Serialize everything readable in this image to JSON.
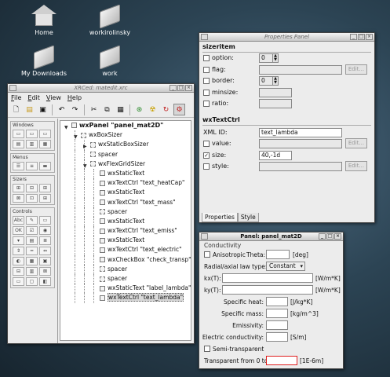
{
  "desktop": {
    "icons": [
      "Home",
      "workirolinsky",
      "My Downloads",
      "work"
    ]
  },
  "xrced": {
    "title": "XRCed: matedit.xrc",
    "menu": [
      "File",
      "Edit",
      "View",
      "Help"
    ],
    "toolbar_icons": [
      "new-icon",
      "open-icon",
      "save-icon",
      "undo-icon",
      "redo-icon",
      "cut-icon",
      "copy-icon",
      "paste-icon",
      "test-icon",
      "locate-icon",
      "refresh-icon",
      "auto-refresh-icon"
    ],
    "palette": [
      {
        "title": "Windows",
        "count": 6
      },
      {
        "title": "Menus",
        "count": 3
      },
      {
        "title": "Sizers",
        "count": 6
      },
      {
        "title": "Controls",
        "count": 21
      }
    ],
    "tree": [
      {
        "label": "wxPanel \"panel_mat2D\"",
        "level": 0,
        "root": true,
        "expander": "▼"
      },
      {
        "label": "wxBoxSizer",
        "level": 1,
        "expander": "▼"
      },
      {
        "label": "wxStaticBoxSizer",
        "level": 2,
        "expander": "▶"
      },
      {
        "label": "spacer",
        "level": 2
      },
      {
        "label": "wxFlexGridSizer",
        "level": 2,
        "expander": "▼"
      },
      {
        "label": "wxStaticText",
        "level": 3
      },
      {
        "label": "wxTextCtrl \"text_heatCap\"",
        "level": 3
      },
      {
        "label": "wxStaticText",
        "level": 3
      },
      {
        "label": "wxTextCtrl \"text_mass\"",
        "level": 3
      },
      {
        "label": "spacer",
        "level": 3
      },
      {
        "label": "wxStaticText",
        "level": 3
      },
      {
        "label": "wxTextCtrl \"text_emiss\"",
        "level": 3
      },
      {
        "label": "wxStaticText",
        "level": 3
      },
      {
        "label": "wxTextCtrl \"text_electric\"",
        "level": 3
      },
      {
        "label": "wxCheckBox \"check_transp\"",
        "level": 3
      },
      {
        "label": "spacer",
        "level": 3
      },
      {
        "label": "spacer",
        "level": 3
      },
      {
        "label": "wxStaticText \"label_lambda\"",
        "level": 3
      },
      {
        "label": "wxTextCtrl \"text_lambda\"",
        "level": 3,
        "selected": true
      }
    ]
  },
  "props": {
    "title": "Properties Panel",
    "sizeritem_header": "sizeritem",
    "option_label": "option:",
    "option_value": "0",
    "flag_label": "flag:",
    "border_label": "border:",
    "border_value": "0",
    "minsize_label": "minsize:",
    "ratio_label": "ratio:",
    "edit_label": "Edit...",
    "textctrl_header": "wxTextCtrl",
    "xmlid_label": "XML ID:",
    "xmlid_value": "text_lambda",
    "value_label": "value:",
    "size_label": "size:",
    "size_value": "40,-1d",
    "style_label": "style:",
    "tabs": [
      "Properties",
      "Style"
    ]
  },
  "panel": {
    "title": "Panel: panel_mat2D",
    "conductivity_label": "Conductivity",
    "anisotropic_label": "Anisotropic",
    "theta_label": "Theta:",
    "deg_unit": "[deg]",
    "law_label": "Radial/axial law type:",
    "law_value": "Constant",
    "kx_label": "kx(T):",
    "ky_label": "ky(T):",
    "wmk_unit": "[W/m*K]",
    "heat_label": "Specific heat:",
    "heat_unit": "[J/kg*K]",
    "mass_label": "Specific mass:",
    "mass_unit": "[kg/m^3]",
    "emiss_label": "Emissivity:",
    "elec_label": "Electric conductivity:",
    "elec_unit": "[S/m]",
    "semi_label": "Semi-transparent",
    "transp_label": "Transparent from 0 to:",
    "transp_unit": "[1E-6m]"
  }
}
